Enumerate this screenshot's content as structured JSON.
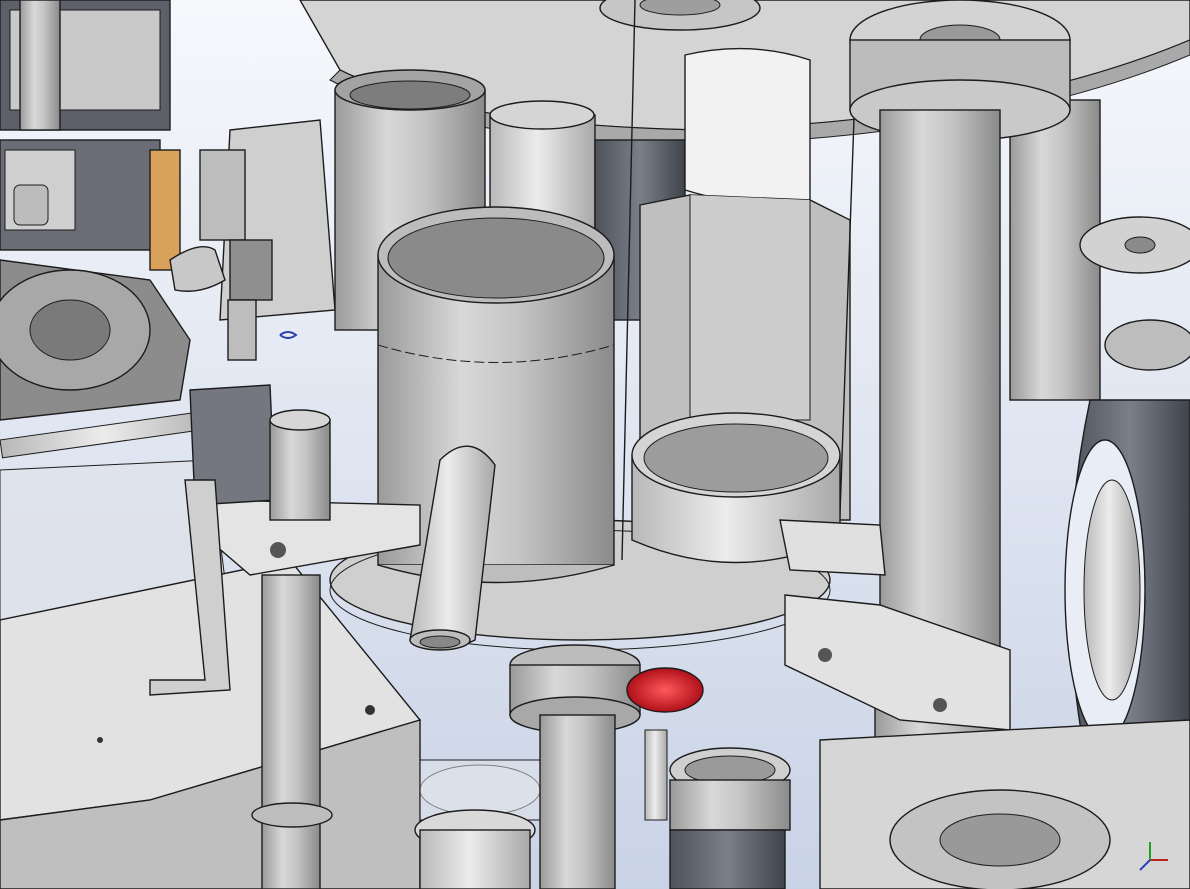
{
  "viewport": {
    "background_top": "#f6f8fc",
    "background_bottom": "#c9d3e6"
  },
  "colors": {
    "metal_light": "#d9d9d9",
    "metal_mid": "#bdbdbd",
    "metal_dark": "#8f8f8f",
    "edge": "#1c1c1c",
    "panel_dark": "#5c5f66",
    "highlight_red": "#e0202a",
    "wood": "#d9a25a",
    "wire_blue": "#2a3fb0"
  },
  "icons": {
    "axis_triad": "triad-icon"
  }
}
